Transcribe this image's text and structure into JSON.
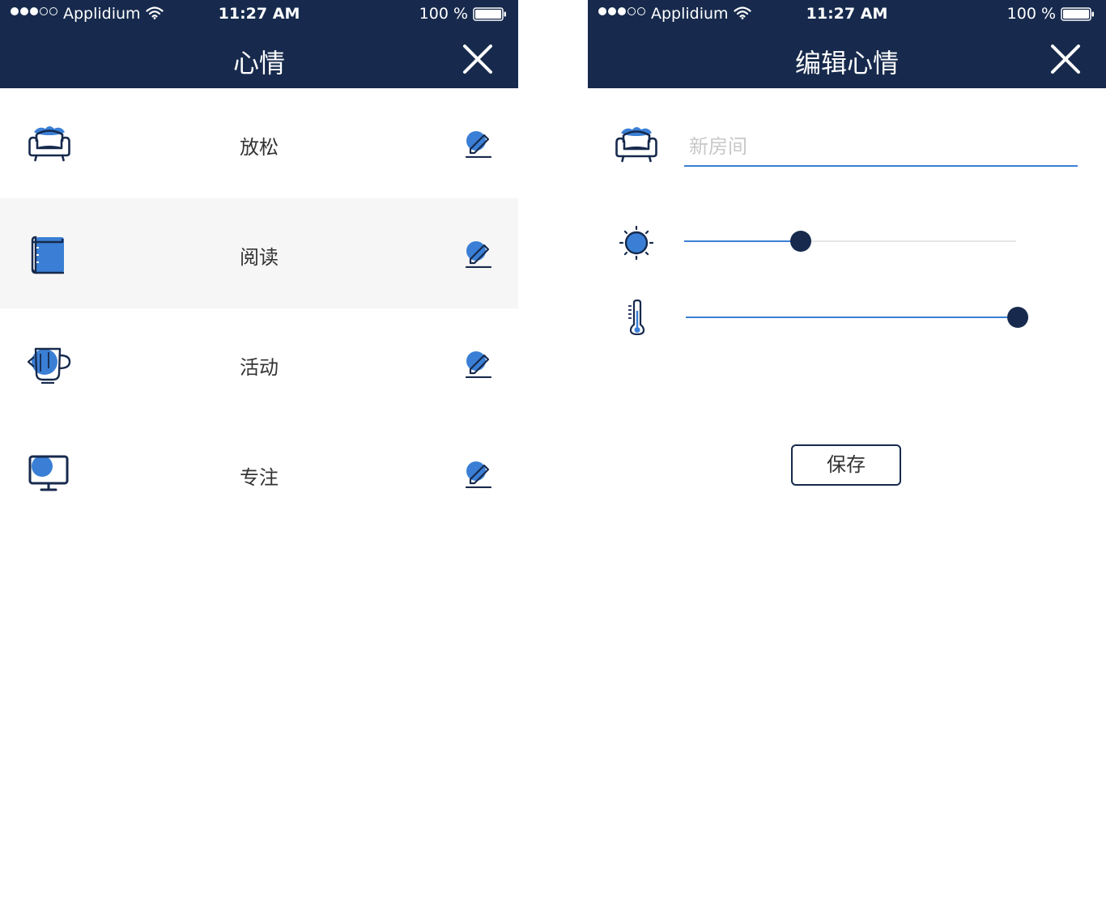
{
  "colors": {
    "nav_background": "#172a4d",
    "accent": "#3a7fd5",
    "highlight_row": "#f6f6f6"
  },
  "status_bar": {
    "carrier": "Applidium",
    "time": "11:27 AM",
    "battery": "100 %"
  },
  "list_screen": {
    "title": "心情",
    "close_icon": "close-icon",
    "rows": [
      {
        "label": "放松",
        "icon": "armchair-icon",
        "edit_icon": "edit-icon",
        "highlighted": false
      },
      {
        "label": "阅读",
        "icon": "book-icon",
        "edit_icon": "edit-icon",
        "highlighted": true
      },
      {
        "label": "活动",
        "icon": "mug-icon",
        "edit_icon": "edit-icon",
        "highlighted": false
      },
      {
        "label": "专注",
        "icon": "tv-icon",
        "edit_icon": "edit-icon",
        "highlighted": false
      }
    ]
  },
  "edit_screen": {
    "title": "编辑心情",
    "close_icon": "close-icon",
    "name_field": {
      "placeholder": "新房间",
      "value": "",
      "icon": "armchair-icon"
    },
    "brightness": {
      "icon": "sun-icon",
      "level": 0.35
    },
    "temperature": {
      "icon": "thermometer-icon",
      "level": 1.0
    },
    "save_label": "保存"
  }
}
